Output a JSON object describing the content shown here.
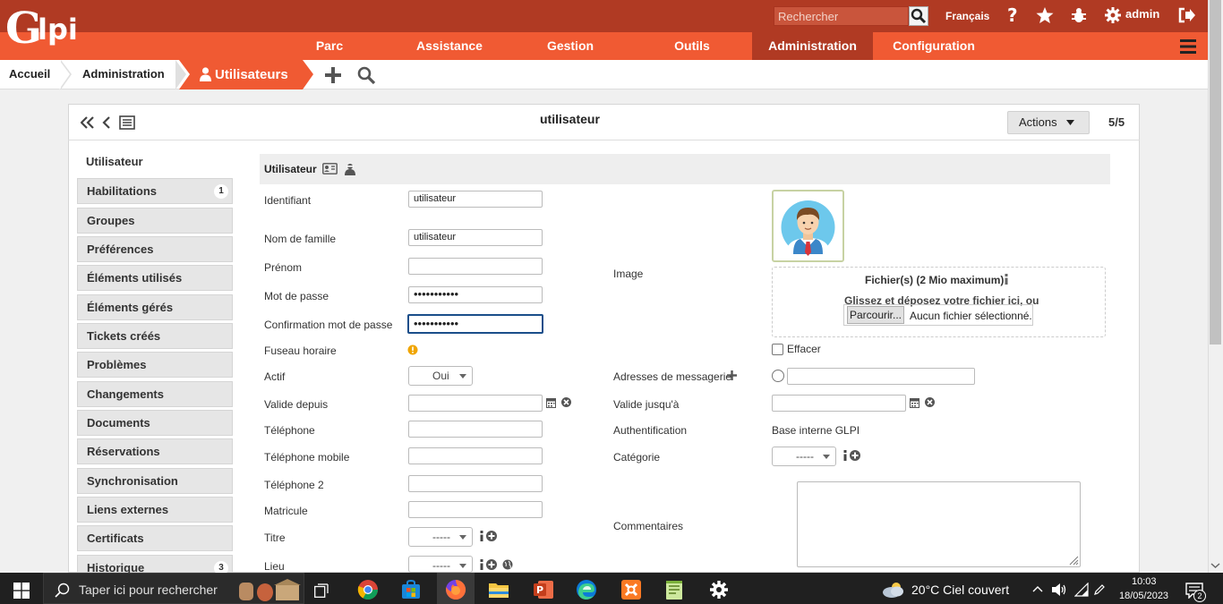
{
  "topbar": {
    "search_placeholder": "Rechercher",
    "language": "Français",
    "user": "admin"
  },
  "menu": {
    "items": [
      "Parc",
      "Assistance",
      "Gestion",
      "Outils",
      "Administration",
      "Configuration"
    ],
    "active": "Administration"
  },
  "breadcrumb": {
    "home": "Accueil",
    "section": "Administration",
    "current": "Utilisateurs"
  },
  "card": {
    "title": "utilisateur",
    "actions_label": "Actions",
    "counter": "5/5"
  },
  "tabs": [
    {
      "label": "Utilisateur",
      "badge": ""
    },
    {
      "label": "Habilitations",
      "badge": "1"
    },
    {
      "label": "Groupes",
      "badge": ""
    },
    {
      "label": "Préférences",
      "badge": ""
    },
    {
      "label": "Éléments utilisés",
      "badge": ""
    },
    {
      "label": "Éléments gérés",
      "badge": ""
    },
    {
      "label": "Tickets créés",
      "badge": ""
    },
    {
      "label": "Problèmes",
      "badge": ""
    },
    {
      "label": "Changements",
      "badge": ""
    },
    {
      "label": "Documents",
      "badge": ""
    },
    {
      "label": "Réservations",
      "badge": ""
    },
    {
      "label": "Synchronisation",
      "badge": ""
    },
    {
      "label": "Liens externes",
      "badge": ""
    },
    {
      "label": "Certificats",
      "badge": ""
    },
    {
      "label": "Historique",
      "badge": "3"
    }
  ],
  "form": {
    "section_title": "Utilisateur",
    "login_label": "Identifiant",
    "login_value": "utilisateur",
    "lastname_label": "Nom de famille",
    "lastname_value": "utilisateur",
    "firstname_label": "Prénom",
    "password_label": "Mot de passe",
    "password_value": "•••••••••••",
    "password_confirm_label": "Confirmation mot de passe",
    "password_confirm_value": "•••••••••••",
    "timezone_label": "Fuseau horaire",
    "active_label": "Actif",
    "active_value": "Oui",
    "valid_from_label": "Valide depuis",
    "phone_label": "Téléphone",
    "mobile_label": "Téléphone mobile",
    "phone2_label": "Téléphone 2",
    "registration_label": "Matricule",
    "title_label": "Titre",
    "title_value": "-----",
    "location_label": "Lieu",
    "location_value": "-----",
    "image_label": "Image",
    "upload_heading": "Fichier(s) (2 Mio maximum)",
    "upload_drop": "Glissez et déposez votre fichier ici, ou",
    "browse_label": "Parcourir...",
    "no_file": "Aucun fichier sélectionné.",
    "erase_label": "Effacer",
    "emails_label": "Adresses de messagerie",
    "valid_until_label": "Valide jusqu'à",
    "auth_label": "Authentification",
    "auth_value": "Base interne GLPI",
    "category_label": "Catégorie",
    "category_value": "-----",
    "comments_label": "Commentaires"
  },
  "taskbar": {
    "search_placeholder": "Taper ici pour rechercher",
    "weather": "20°C  Ciel couvert",
    "time": "10:03",
    "date": "18/05/2023",
    "notifications": "2"
  }
}
